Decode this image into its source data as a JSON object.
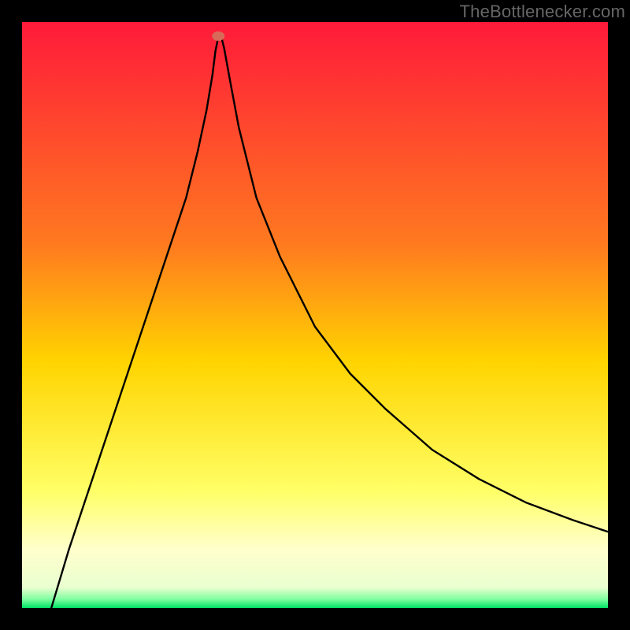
{
  "watermark": "TheBottlenecker.com",
  "chart_data": {
    "type": "line",
    "title": "",
    "xlabel": "",
    "ylabel": "",
    "xlim": [
      0,
      100
    ],
    "ylim": [
      0,
      100
    ],
    "gradient_stops": [
      {
        "offset": 0,
        "color": "#ff1a3a"
      },
      {
        "offset": 0.38,
        "color": "#ff7a1f"
      },
      {
        "offset": 0.58,
        "color": "#ffd400"
      },
      {
        "offset": 0.8,
        "color": "#ffff66"
      },
      {
        "offset": 0.9,
        "color": "#ffffcc"
      },
      {
        "offset": 0.965,
        "color": "#eaffd0"
      },
      {
        "offset": 0.985,
        "color": "#7fffa0"
      },
      {
        "offset": 1.0,
        "color": "#00e266"
      }
    ],
    "minimum_marker": {
      "x": 33.5,
      "y": 97.6,
      "color": "#d86a5a"
    },
    "series": [
      {
        "name": "bottleneck-curve",
        "x": [
          5,
          8,
          12,
          16,
          20,
          24,
          28,
          30,
          31.5,
          32.5,
          33,
          33.5,
          34,
          34.5,
          35.5,
          37,
          40,
          44,
          50,
          56,
          62,
          70,
          78,
          86,
          94,
          100
        ],
        "y": [
          0,
          10,
          22,
          34,
          46,
          58,
          70,
          78,
          85,
          91,
          95,
          97.5,
          97.5,
          95.5,
          90,
          82,
          70,
          60,
          48,
          40,
          34,
          27,
          22,
          18,
          15,
          13
        ]
      }
    ]
  }
}
